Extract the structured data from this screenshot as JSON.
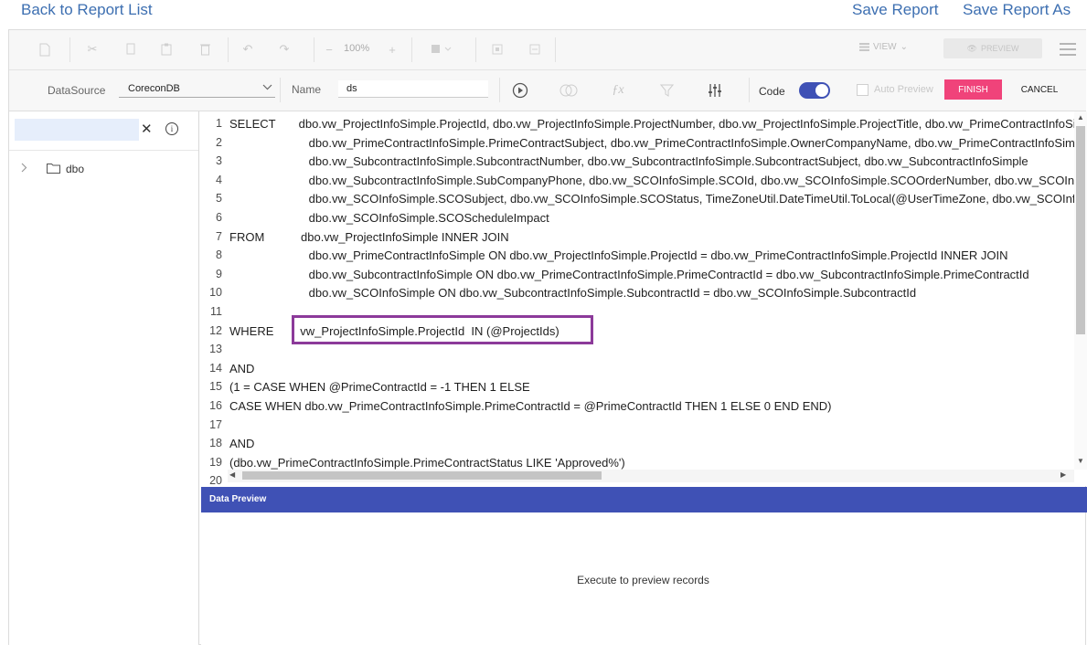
{
  "nav": {
    "back": "Back to Report List",
    "save": "Save Report",
    "save_as": "Save Report As"
  },
  "toolbar": {
    "zoom": "100%",
    "view_label": "VIEW",
    "preview_label": "PREVIEW",
    "icons": [
      "new-file-icon",
      "cut-icon",
      "copy-icon",
      "paste-icon",
      "delete-icon",
      "undo-icon",
      "redo-icon",
      "zoom-out-icon",
      "zoom-in-icon",
      "fill-color-icon",
      "group-icon",
      "ungroup-icon",
      "view-icon",
      "eye-icon",
      "menu-icon"
    ]
  },
  "datasource": {
    "label": "DataSource",
    "selected": "CoreconDB",
    "name_label": "Name",
    "name_value": "ds",
    "code_label": "Code",
    "code_enabled": true,
    "auto_preview_label": "Auto Preview",
    "auto_preview_checked": false,
    "finish": "FINISH",
    "cancel": "CANCEL"
  },
  "left_panel": {
    "search_value": "",
    "clear_icon": "close-icon",
    "info_icon": "info-icon",
    "tree": [
      {
        "label": "dbo",
        "expanded": false
      }
    ]
  },
  "editor": {
    "lines": [
      {
        "num": "1",
        "text": "SELECT       dbo.vw_ProjectInfoSimple.ProjectId, dbo.vw_ProjectInfoSimple.ProjectNumber, dbo.vw_ProjectInfoSimple.ProjectTitle, dbo.vw_PrimeContractInfoSimple.PrimeContractId"
      },
      {
        "num": "2",
        "text": "                        dbo.vw_PrimeContractInfoSimple.PrimeContractSubject, dbo.vw_PrimeContractInfoSimple.OwnerCompanyName, dbo.vw_PrimeContractInfoSimple"
      },
      {
        "num": "3",
        "text": "                        dbo.vw_SubcontractInfoSimple.SubcontractNumber, dbo.vw_SubcontractInfoSimple.SubcontractSubject, dbo.vw_SubcontractInfoSimple"
      },
      {
        "num": "4",
        "text": "                        dbo.vw_SubcontractInfoSimple.SubCompanyPhone, dbo.vw_SCOInfoSimple.SCOId, dbo.vw_SCOInfoSimple.SCOOrderNumber, dbo.vw_SCOInfoSimple"
      },
      {
        "num": "5",
        "text": "                        dbo.vw_SCOInfoSimple.SCOSubject, dbo.vw_SCOInfoSimple.SCOStatus, TimeZoneUtil.DateTimeUtil.ToLocal(@UserTimeZone, dbo.vw_SCOInfoSimple"
      },
      {
        "num": "6",
        "text": "                        dbo.vw_SCOInfoSimple.SCOScheduleImpact"
      },
      {
        "num": "7",
        "text": "FROM           dbo.vw_ProjectInfoSimple INNER JOIN"
      },
      {
        "num": "8",
        "text": "                        dbo.vw_PrimeContractInfoSimple ON dbo.vw_ProjectInfoSimple.ProjectId = dbo.vw_PrimeContractInfoSimple.ProjectId INNER JOIN"
      },
      {
        "num": "9",
        "text": "                        dbo.vw_SubcontractInfoSimple ON dbo.vw_PrimeContractInfoSimple.PrimeContractId = dbo.vw_SubcontractInfoSimple.PrimeContractId"
      },
      {
        "num": "10",
        "text": "                        dbo.vw_SCOInfoSimple ON dbo.vw_SubcontractInfoSimple.SubcontractId = dbo.vw_SCOInfoSimple.SubcontractId"
      },
      {
        "num": "11",
        "text": ""
      },
      {
        "num": "12",
        "text": "WHERE        vw_ProjectInfoSimple.ProjectId  IN (@ProjectIds)"
      },
      {
        "num": "13",
        "text": ""
      },
      {
        "num": "14",
        "text": "AND"
      },
      {
        "num": "15",
        "text": "(1 = CASE WHEN @PrimeContractId = -1 THEN 1 ELSE"
      },
      {
        "num": "16",
        "text": "CASE WHEN dbo.vw_PrimeContractInfoSimple.PrimeContractId = @PrimeContractId THEN 1 ELSE 0 END END)"
      },
      {
        "num": "17",
        "text": ""
      },
      {
        "num": "18",
        "text": "AND"
      },
      {
        "num": "19",
        "text": "(dbo.vw_PrimeContractInfoSimple.PrimeContractStatus LIKE 'Approved%')"
      },
      {
        "num": "20",
        "text": ""
      }
    ]
  },
  "preview": {
    "title": "Data Preview",
    "message": "Execute to preview records"
  },
  "colors": {
    "accent": "#3f51b5",
    "finish": "#f0437a",
    "link": "#3d6fb1",
    "highlight_border": "#8c3a9a"
  }
}
